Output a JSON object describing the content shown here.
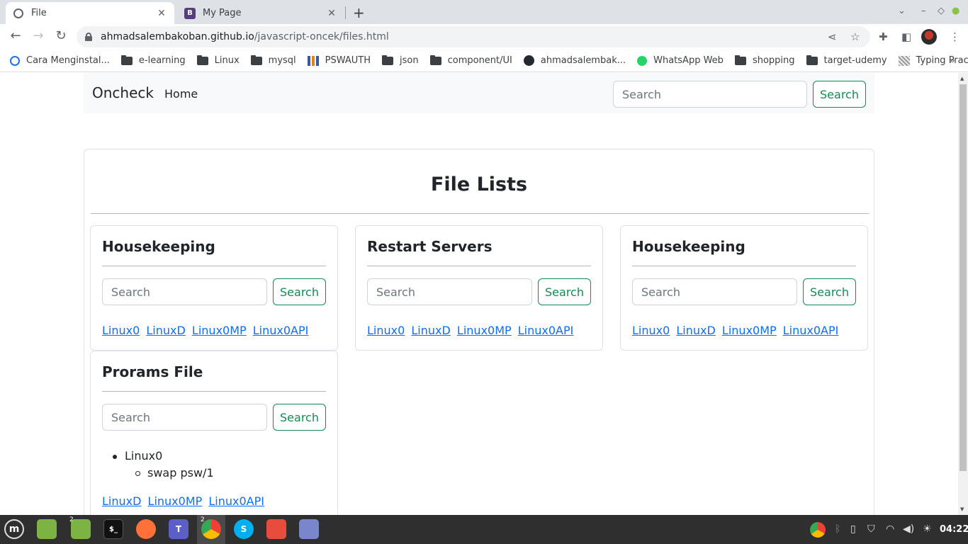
{
  "browser": {
    "tabs": [
      {
        "title": "File",
        "favicon": "globe-icon",
        "active": true
      },
      {
        "title": "My Page",
        "favicon": "bootstrap-icon",
        "favicon_letter": "B",
        "active": false
      }
    ],
    "address": {
      "host": "ahmadsalembakoban.github.io",
      "path": "/javascript-oncek/files.html"
    },
    "bookmarks": [
      {
        "label": "Cara Menginstal...",
        "icon": "site-icon"
      },
      {
        "label": "e-learning",
        "icon": "folder-icon"
      },
      {
        "label": "Linux",
        "icon": "folder-icon"
      },
      {
        "label": "mysql",
        "icon": "folder-icon"
      },
      {
        "label": "PSWAUTH",
        "icon": "site-icon"
      },
      {
        "label": "json",
        "icon": "folder-icon"
      },
      {
        "label": "component/UI",
        "icon": "folder-icon"
      },
      {
        "label": "ahmadsalembak...",
        "icon": "github-icon"
      },
      {
        "label": "WhatsApp Web",
        "icon": "whatsapp-icon"
      },
      {
        "label": "shopping",
        "icon": "folder-icon"
      },
      {
        "label": "target-udemy",
        "icon": "folder-icon"
      },
      {
        "label": "Typing Practice",
        "icon": "site-icon"
      }
    ]
  },
  "navbar": {
    "brand": "Oncheck",
    "home": "Home",
    "search_placeholder": "Search",
    "search_button": "Search"
  },
  "page": {
    "title": "File Lists",
    "cards": [
      {
        "title": "Housekeeping",
        "search_placeholder": "Search",
        "search_button": "Search",
        "links": [
          "Linux0",
          "LinuxD",
          "Linux0MP",
          "Linux0API"
        ]
      },
      {
        "title": "Restart Servers",
        "search_placeholder": "Search",
        "search_button": "Search",
        "links": [
          "Linux0",
          "LinuxD",
          "Linux0MP",
          "Linux0API"
        ]
      },
      {
        "title": "Housekeeping",
        "search_placeholder": "Search",
        "search_button": "Search",
        "links": [
          "Linux0",
          "LinuxD",
          "Linux0MP",
          "Linux0API"
        ]
      },
      {
        "title": "Prorams File",
        "search_placeholder": "Search",
        "search_button": "Search",
        "list": {
          "item": "Linux0",
          "subitem": "swap psw/1"
        },
        "links": [
          "LinuxD",
          "Linux0MP",
          "Linux0API"
        ]
      }
    ]
  },
  "taskbar": {
    "apps": [
      {
        "name": "menu-icon"
      },
      {
        "name": "files-icon"
      },
      {
        "name": "files-icon",
        "badge": "2"
      },
      {
        "name": "terminal-icon"
      },
      {
        "name": "firefox-icon"
      },
      {
        "name": "teams-icon"
      },
      {
        "name": "chrome-icon",
        "badge": "2"
      },
      {
        "name": "skype-icon"
      },
      {
        "name": "screenshot-icon"
      },
      {
        "name": "text-editor-icon"
      }
    ],
    "clock": "04:22"
  },
  "colors": {
    "success": "#198754",
    "link": "#0d6efd",
    "navbar_bg": "#f8f9fa"
  }
}
